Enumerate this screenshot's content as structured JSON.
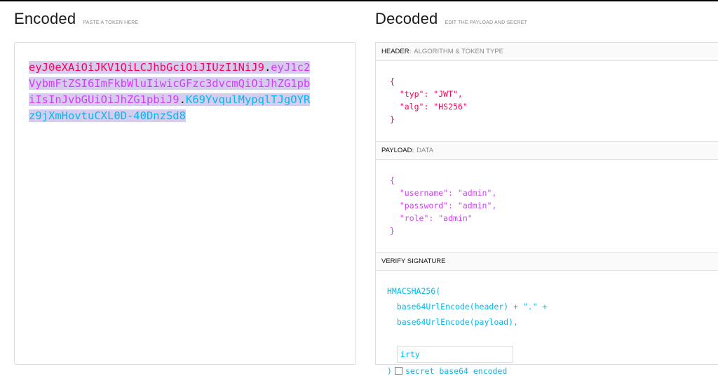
{
  "encoded": {
    "title": "Encoded",
    "subtitle": "PASTE A TOKEN HERE",
    "token_header": "eyJ0eXAiOiJKV1QiLCJhbGciOiJIUzI1NiJ9",
    "token_payload": "eyJ1c2VybmFtZSI6ImFkbWluIiwicGFzc3dvcmQiOiJhZG1pbiIsInJvbGUiOiJhZG1pbiJ9",
    "token_signature": "K69YvqulMypqlTJgOYRz9jXmHovtuCXL0D-40DnzSd8",
    "dot": "."
  },
  "decoded": {
    "title": "Decoded",
    "subtitle": "EDIT THE PAYLOAD AND SECRET",
    "header_section": {
      "label": "HEADER:",
      "sublabel": "ALGORITHM & TOKEN TYPE",
      "lines": [
        "{",
        "  \"typ\": \"JWT\",",
        "  \"alg\": \"HS256\"",
        "}"
      ]
    },
    "payload_section": {
      "label": "PAYLOAD:",
      "sublabel": "DATA",
      "lines": [
        "{",
        "  \"username\": \"admin\",",
        "  \"password\": \"admin\",",
        "  \"role\": \"admin\"",
        "}"
      ]
    },
    "signature_section": {
      "label": "VERIFY SIGNATURE",
      "func": "HMACSHA256(",
      "line1": "  base64UrlEncode(header) + \".\" +",
      "line2": "  base64UrlEncode(payload),",
      "secret_value": "irty",
      "close_paren": ")",
      "checkbox_label": "secret base64 encoded"
    }
  },
  "colors": {
    "header": "#fb015b",
    "payload": "#d63aff",
    "signature": "#00b9f1",
    "highlight": "#d6cdee"
  }
}
